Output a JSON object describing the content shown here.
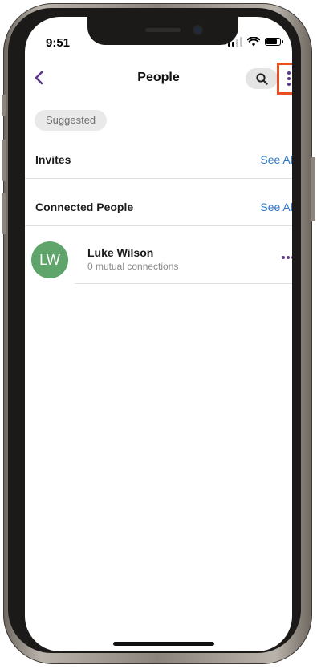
{
  "status_bar": {
    "time": "9:51",
    "battery_level": 0.85
  },
  "header": {
    "title": "People",
    "back_icon": "chevron-left-icon",
    "search_icon": "search-icon",
    "more_icon": "vertical-ellipsis-icon"
  },
  "filters": {
    "chip_label": "Suggested"
  },
  "sections": {
    "invites": {
      "title": "Invites",
      "see_all": "See All"
    },
    "connected": {
      "title": "Connected People",
      "see_all": "See All"
    }
  },
  "people": [
    {
      "initials": "LW",
      "name": "Luke Wilson",
      "subtitle": "0 mutual connections"
    }
  ],
  "colors": {
    "accent_purple": "#5d3a8c",
    "link_blue": "#2f78c9",
    "avatar_green": "#5fa46a",
    "highlight_orange": "#ec4e20"
  }
}
